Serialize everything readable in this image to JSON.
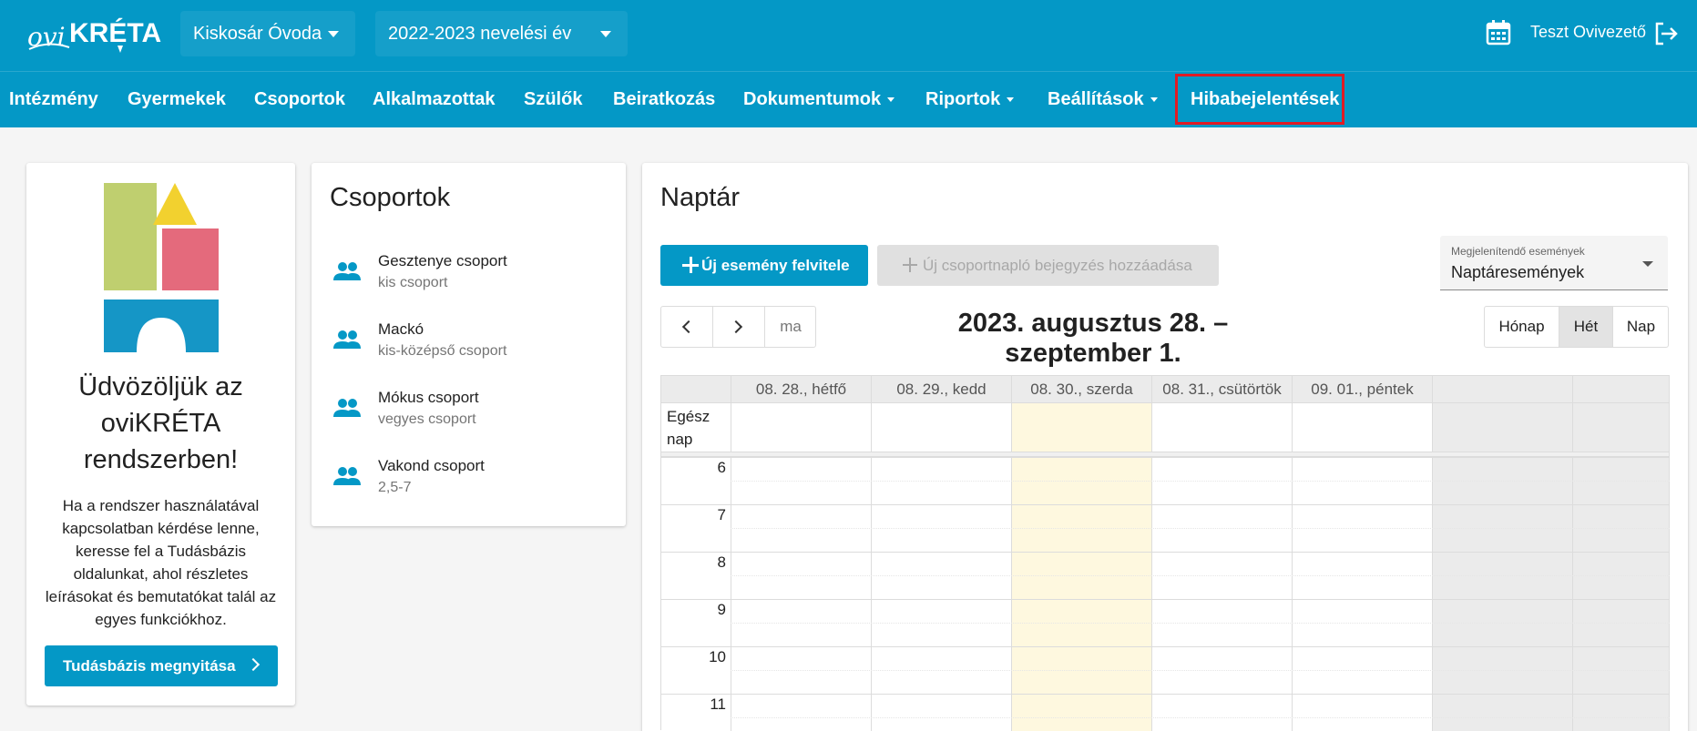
{
  "header": {
    "logo_text": "oviKRÉTA",
    "institution": "Kiskosár Óvoda",
    "school_year": "2022-2023 nevelési év",
    "user_name": "Teszt Ovivezető"
  },
  "nav": {
    "items": [
      {
        "label": "Intézmény",
        "dropdown": false
      },
      {
        "label": "Gyermekek",
        "dropdown": false
      },
      {
        "label": "Csoportok",
        "dropdown": false
      },
      {
        "label": "Alkalmazottak",
        "dropdown": false
      },
      {
        "label": "Szülők",
        "dropdown": false
      },
      {
        "label": "Beiratkozás",
        "dropdown": false
      },
      {
        "label": "Dokumentumok",
        "dropdown": true
      },
      {
        "label": "Riportok",
        "dropdown": true
      },
      {
        "label": "Beállítások",
        "dropdown": true
      },
      {
        "label": "Hibabejelentések",
        "dropdown": false
      }
    ],
    "highlight_color": "#e01b24"
  },
  "welcome": {
    "title": "Üdvözöljük az oviKRÉTA rendszerben!",
    "text": "Ha a rendszer használatával kapcsolatban kérdése lenne, keresse fel a Tudásbázis oldalunkat, ahol részletes leírásokat és bemutatókat talál az egyes funkciókhoz.",
    "button": "Tudásbázis megnyitása"
  },
  "groups": {
    "title": "Csoportok",
    "items": [
      {
        "name": "Gesztenye csoport",
        "sub": "kis csoport"
      },
      {
        "name": "Mackó",
        "sub": "kis-középső csoport"
      },
      {
        "name": "Mókus csoport",
        "sub": "vegyes csoport"
      },
      {
        "name": "Vakond csoport",
        "sub": "2,5-7"
      }
    ]
  },
  "calendar": {
    "title": "Naptár",
    "new_event": "Új esemény felvitele",
    "new_log": "Új csoportnapló bejegyzés hozzáadása",
    "events_label": "Megjelenítendő események",
    "events_value": "Naptáresemények",
    "today": "ma",
    "range": "2023. augusztus 28. – szeptember 1.",
    "views": {
      "month": "Hónap",
      "week": "Hét",
      "day": "Nap"
    },
    "days": [
      "08. 28., hétfő",
      "08. 29., kedd",
      "08. 30., szerda",
      "08. 31., csütörtök",
      "09. 01., péntek",
      "",
      ""
    ],
    "allday_label": "Egész nap",
    "hours": [
      "6",
      "7",
      "8",
      "9",
      "10",
      "11"
    ]
  },
  "colors": {
    "brand": "#0498c6",
    "today_bg": "#fef8df",
    "weekend_bg": "#ebebeb"
  }
}
